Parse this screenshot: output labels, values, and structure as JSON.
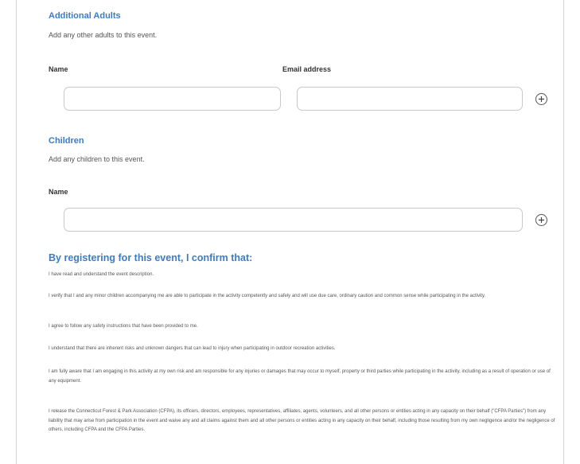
{
  "adults": {
    "title": "Additional Adults",
    "subtitle": "Add any other adults to this event.",
    "name_label": "Name",
    "email_label": "Email address",
    "name_value": "",
    "email_value": ""
  },
  "children": {
    "title": "Children",
    "subtitle": "Add any children to this event.",
    "name_label": "Name",
    "name_value": ""
  },
  "confirm": {
    "title": "By registering for this event, I confirm that:",
    "items": [
      "I have read and understand the event description.",
      "I verify that I and any minor children accompanying me are able to participate in the activity competently and safely and will use due care, ordinary caution and common sense while participating in the activity.",
      "I agree to follow any safety instructions that have been provided to me.",
      "I understand that there are inherent risks and unknown dangers that can lead to injury when participating in outdoor recreation activities.",
      "I am fully aware that I am engaging in this activity at my own risk and am responsible for any injuries or damages that may occur to myself, property or third parties while participating in the activity, including as a result of operation or use of any equipment.",
      "I release the Connecticut Forest & Park Association (CFPA), its officers, directors, employees, representatives, affiliates, agents, volunteers, and all other persons or entities acting in any capacity on their behalf (\"CFPA Parties\") from any liability that may arise from participation in the event and waive any and all claims against them and all other persons or entities acting in any capacity on their behalf, including those resulting from my own negligence and/or the negligence of others, including CFPA and the CFPA Parties."
    ]
  },
  "icons": {
    "add_adult": "plus-circle-icon",
    "add_child": "plus-circle-icon"
  },
  "colors": {
    "accent": "#3d7cbf",
    "border": "#c8c8c8",
    "text": "#333333"
  }
}
